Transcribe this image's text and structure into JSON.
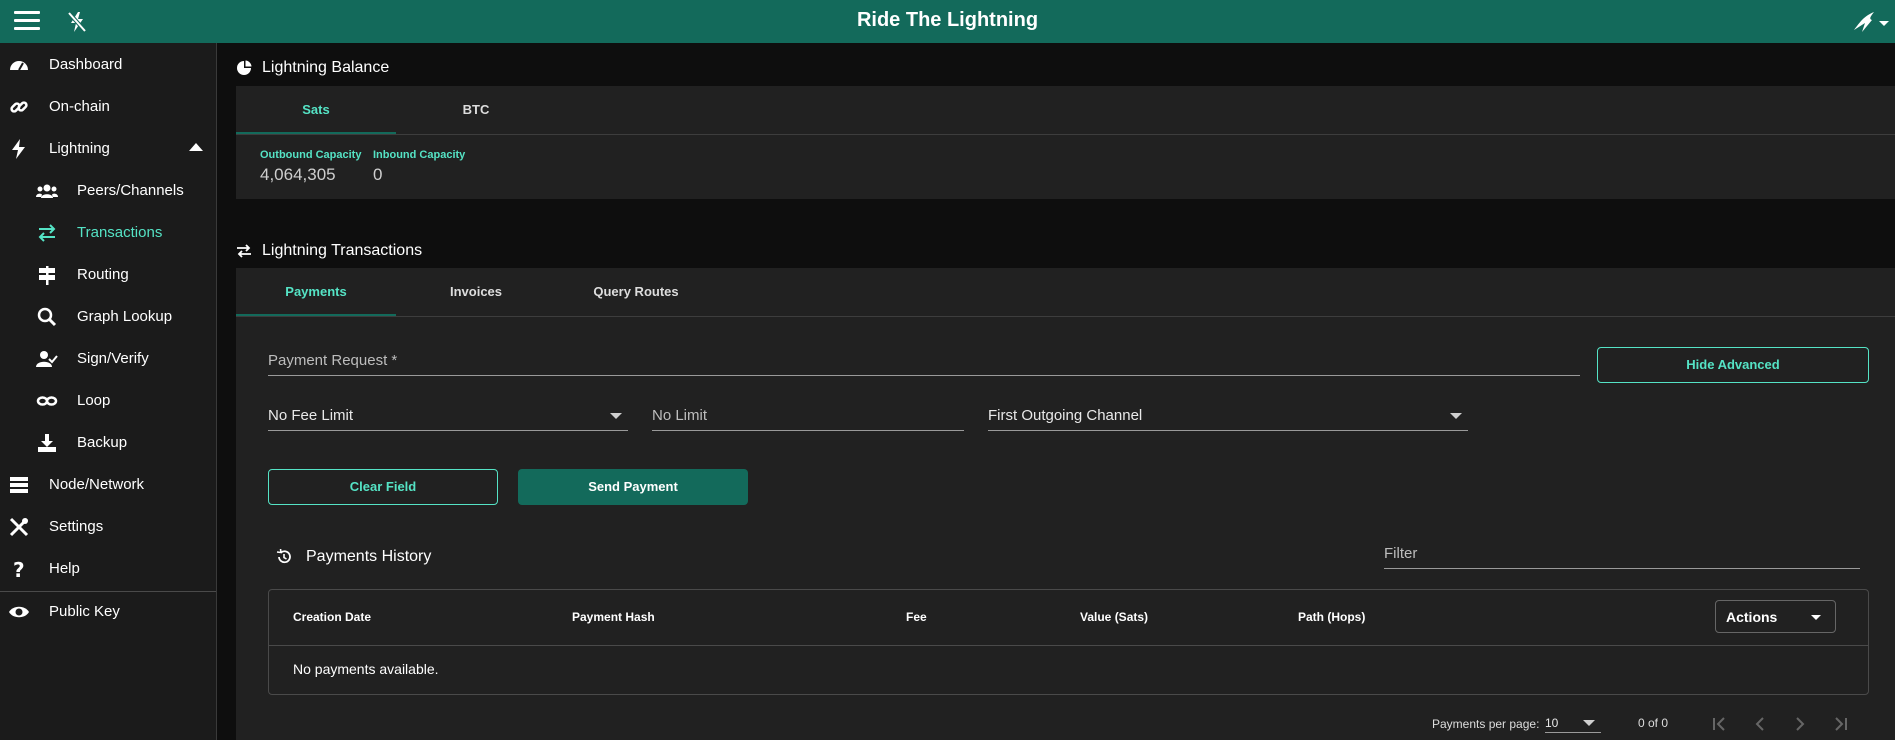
{
  "app": {
    "title": "Ride The Lightning"
  },
  "sidebar": {
    "items": [
      {
        "label": "Dashboard",
        "icon": "dashboard-icon"
      },
      {
        "label": "On-chain",
        "icon": "link-icon"
      },
      {
        "label": "Lightning",
        "icon": "bolt-icon"
      },
      {
        "label": "Peers/Channels",
        "icon": "users-icon"
      },
      {
        "label": "Transactions",
        "icon": "exchange-icon"
      },
      {
        "label": "Routing",
        "icon": "signpost-icon"
      },
      {
        "label": "Graph Lookup",
        "icon": "search-icon"
      },
      {
        "label": "Sign/Verify",
        "icon": "user-check-icon"
      },
      {
        "label": "Loop",
        "icon": "infinity-icon"
      },
      {
        "label": "Backup",
        "icon": "download-icon"
      },
      {
        "label": "Node/Network",
        "icon": "server-icon"
      },
      {
        "label": "Settings",
        "icon": "tools-icon"
      },
      {
        "label": "Help",
        "icon": "question-icon"
      },
      {
        "label": "Public Key",
        "icon": "eye-icon"
      }
    ]
  },
  "balance": {
    "title": "Lightning Balance",
    "tabs": [
      "Sats",
      "BTC"
    ],
    "outbound_label": "Outbound Capacity",
    "outbound_value": "4,064,305",
    "inbound_label": "Inbound Capacity",
    "inbound_value": "0"
  },
  "transactions": {
    "title": "Lightning Transactions",
    "tabs": [
      "Payments",
      "Invoices",
      "Query Routes"
    ],
    "payment_request_label": "Payment Request *",
    "hide_advanced": "Hide Advanced",
    "fee_limit": "No Fee Limit",
    "limit_placeholder": "No Limit",
    "outgoing_channel": "First Outgoing Channel",
    "clear_field": "Clear Field",
    "send_payment": "Send Payment"
  },
  "history": {
    "title": "Payments History",
    "filter_label": "Filter",
    "columns": [
      "Creation Date",
      "Payment Hash",
      "Fee",
      "Value (Sats)",
      "Path (Hops)"
    ],
    "actions_label": "Actions",
    "empty": "No payments available.",
    "per_page_label": "Payments per page:",
    "per_page_value": "10",
    "range": "0 of 0"
  },
  "colors": {
    "primary": "#136a5b",
    "accent": "#55e3c5",
    "surface": "#212121"
  }
}
